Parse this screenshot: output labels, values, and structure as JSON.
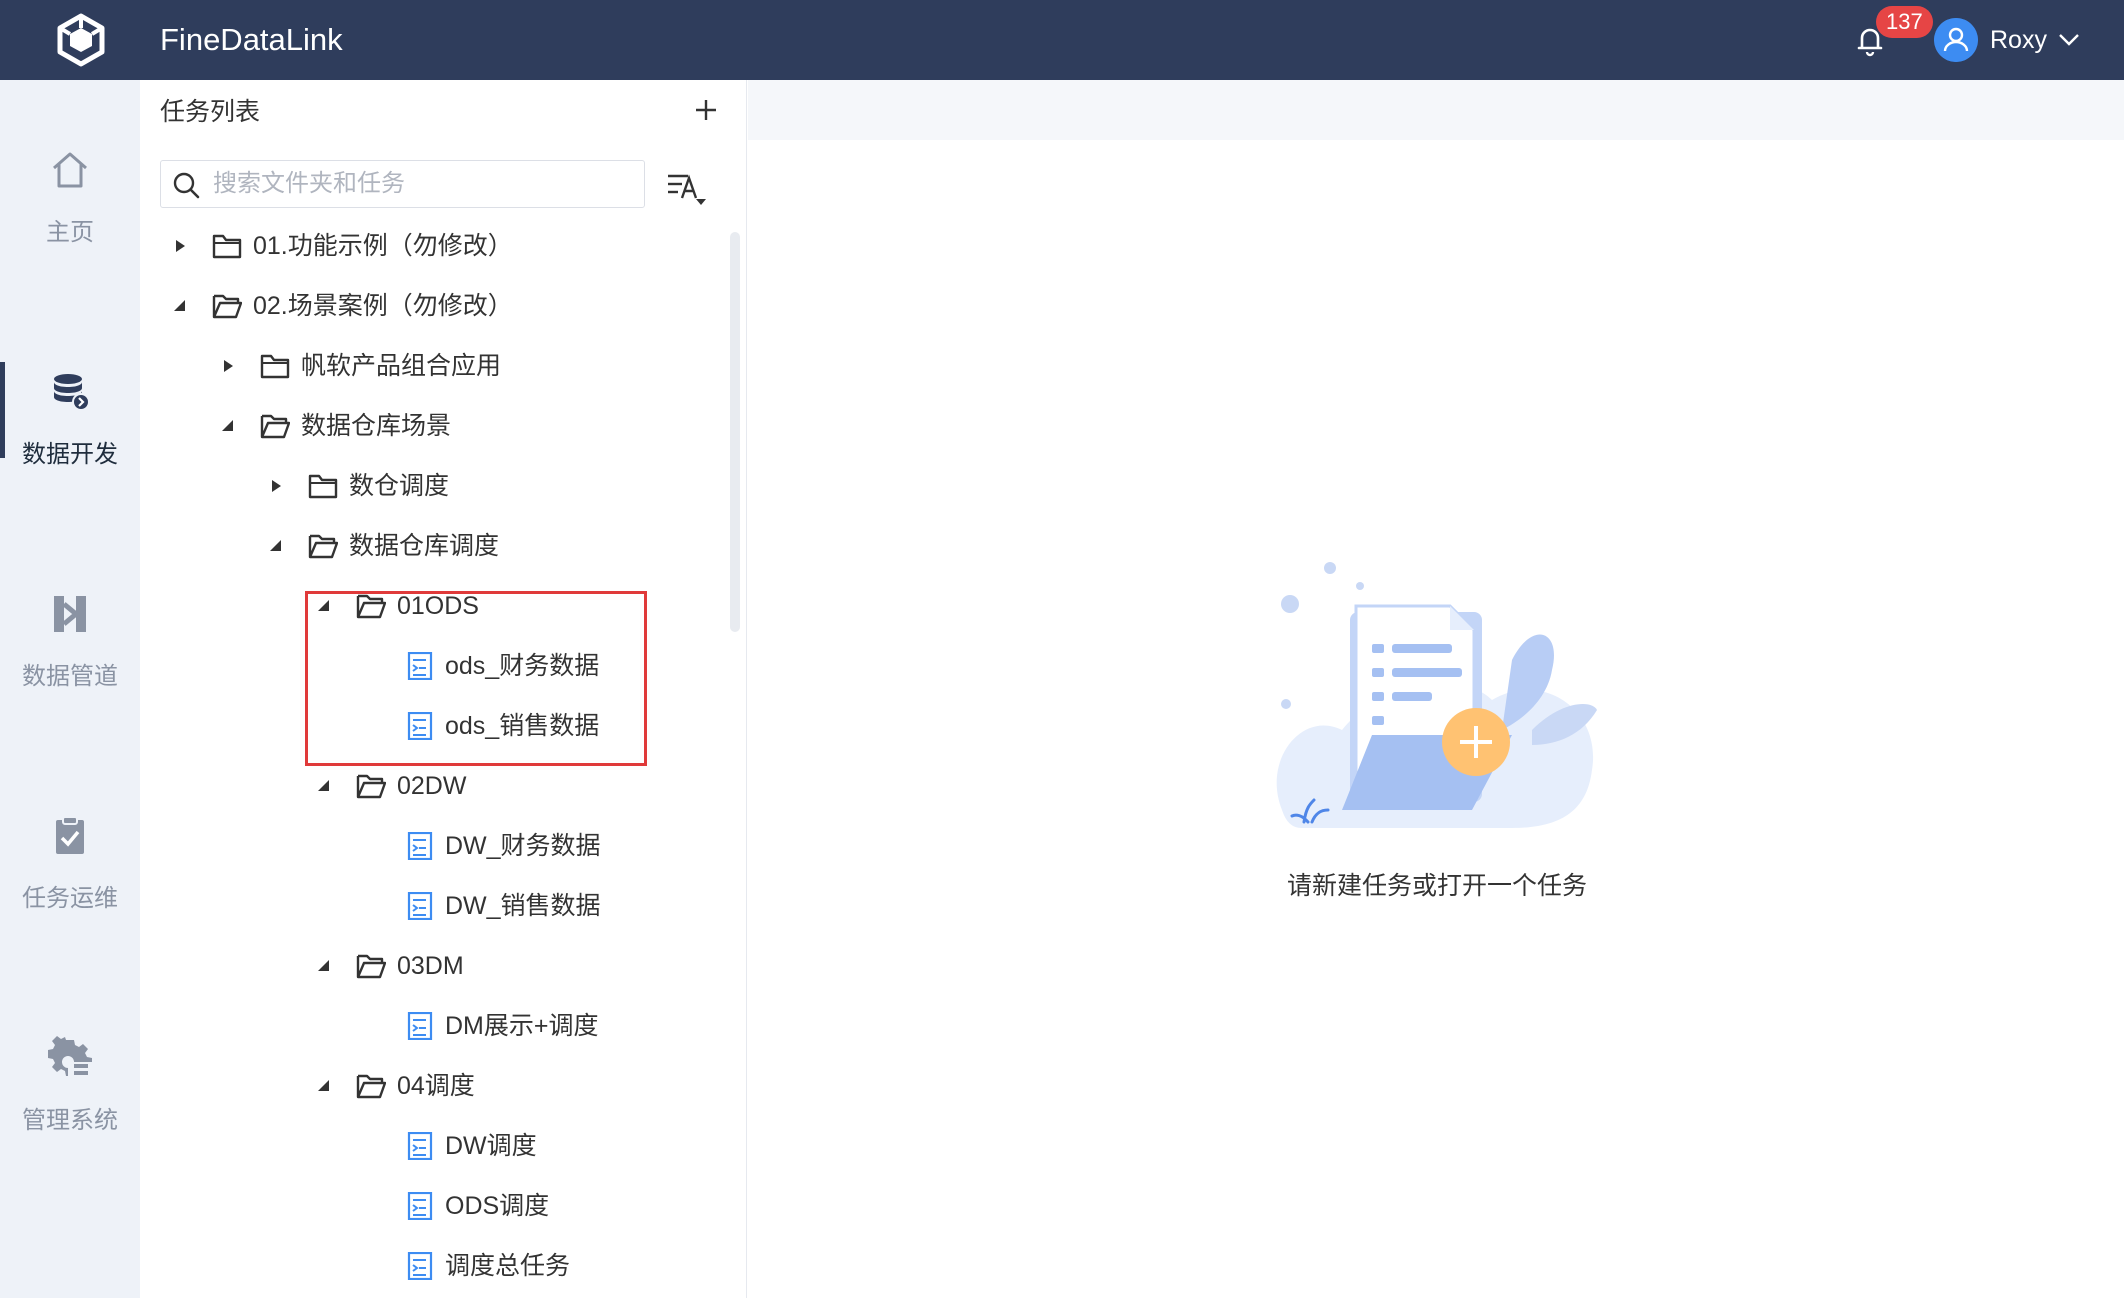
{
  "app": {
    "title": "FineDataLink"
  },
  "header": {
    "notification_count": "137",
    "user_name": "Roxy"
  },
  "nav": {
    "items": [
      {
        "label": "主页",
        "icon": "home-icon"
      },
      {
        "label": "数据开发",
        "icon": "database-icon",
        "active": true
      },
      {
        "label": "数据管道",
        "icon": "pipeline-icon"
      },
      {
        "label": "任务运维",
        "icon": "task-ops-icon"
      },
      {
        "label": "管理系统",
        "icon": "gear-icon"
      }
    ]
  },
  "panel": {
    "title": "任务列表",
    "search_placeholder": "搜索文件夹和任务",
    "tree": [
      {
        "label": "01.功能示例（勿修改）",
        "type": "folder",
        "expanded": false,
        "level": 0
      },
      {
        "label": "02.场景案例（勿修改）",
        "type": "folder",
        "expanded": true,
        "level": 0
      },
      {
        "label": "帆软产品组合应用",
        "type": "folder",
        "expanded": false,
        "level": 1
      },
      {
        "label": "数据仓库场景",
        "type": "folder",
        "expanded": true,
        "level": 1
      },
      {
        "label": "数仓调度",
        "type": "folder",
        "expanded": false,
        "level": 2
      },
      {
        "label": "数据仓库调度",
        "type": "folder",
        "expanded": true,
        "level": 2
      },
      {
        "label": "01ODS",
        "type": "folder",
        "expanded": true,
        "level": 3
      },
      {
        "label": "ods_财务数据",
        "type": "task",
        "level": 4
      },
      {
        "label": "ods_销售数据",
        "type": "task",
        "level": 4
      },
      {
        "label": "02DW",
        "type": "folder",
        "expanded": true,
        "level": 3
      },
      {
        "label": "DW_财务数据",
        "type": "task",
        "level": 4
      },
      {
        "label": "DW_销售数据",
        "type": "task",
        "level": 4
      },
      {
        "label": "03DM",
        "type": "folder",
        "expanded": true,
        "level": 3
      },
      {
        "label": "DM展示+调度",
        "type": "task",
        "level": 4
      },
      {
        "label": "04调度",
        "type": "folder",
        "expanded": true,
        "level": 3
      },
      {
        "label": "DW调度",
        "type": "task",
        "level": 4
      },
      {
        "label": "ODS调度",
        "type": "task",
        "level": 4
      },
      {
        "label": "调度总任务",
        "type": "task",
        "level": 4
      }
    ]
  },
  "content": {
    "empty_text": "请新建任务或打开一个任务"
  },
  "colors": {
    "topbar": "#2f3d5c",
    "accent": "#3d8cf2",
    "highlight": "#e03a3a",
    "badge": "#e64545"
  }
}
